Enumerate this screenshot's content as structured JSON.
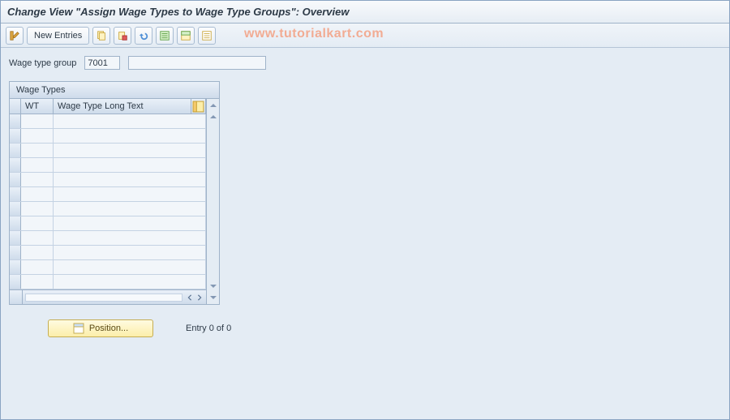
{
  "title": "Change View \"Assign Wage Types to Wage Type Groups\": Overview",
  "toolbar": {
    "new_entries": "New Entries"
  },
  "watermark": "www.tutorialkart.com",
  "field": {
    "label": "Wage type group",
    "value": "7001",
    "desc": ""
  },
  "table": {
    "title": "Wage Types",
    "col_wt": "WT",
    "col_longtext": "Wage Type Long Text",
    "row_count": 12
  },
  "footer": {
    "position_label": "Position...",
    "entry_text": "Entry 0 of 0"
  }
}
